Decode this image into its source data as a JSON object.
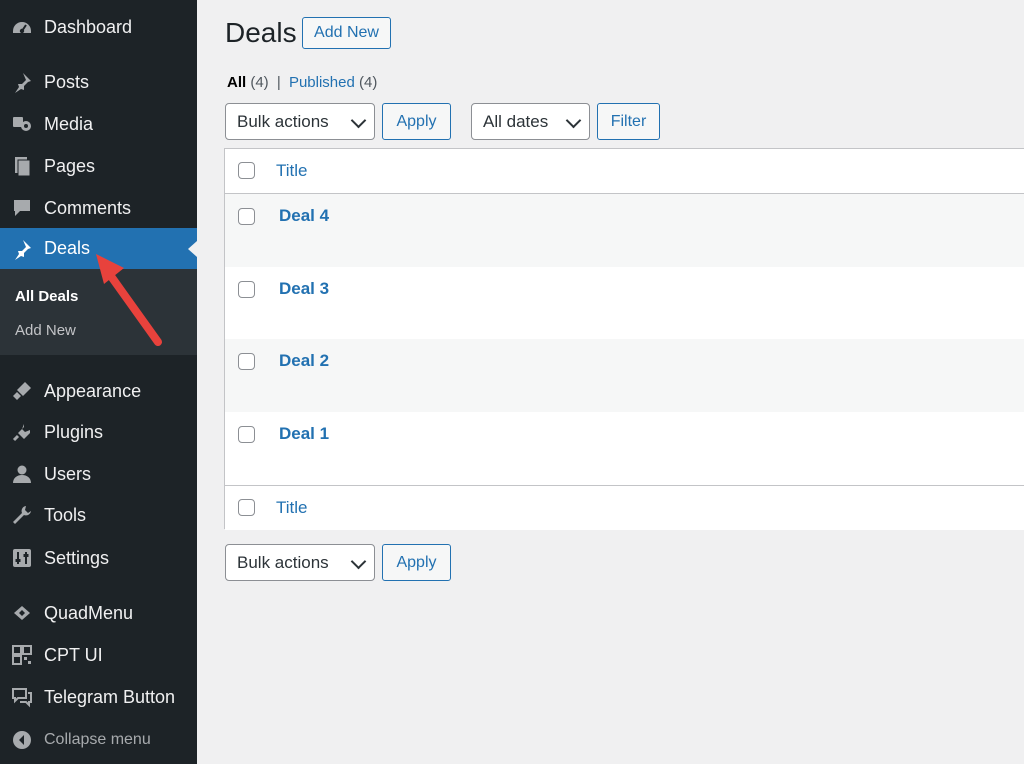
{
  "sidebar": {
    "items": [
      {
        "icon": "dashboard-icon",
        "label": "Dashboard"
      },
      {
        "icon": "pushpin-icon",
        "label": "Posts"
      },
      {
        "icon": "media-icon",
        "label": "Media"
      },
      {
        "icon": "pages-icon",
        "label": "Pages"
      },
      {
        "icon": "comment-icon",
        "label": "Comments"
      },
      {
        "icon": "pushpin-icon",
        "label": "Deals"
      },
      {
        "icon": "appearance-icon",
        "label": "Appearance"
      },
      {
        "icon": "plugin-icon",
        "label": "Plugins"
      },
      {
        "icon": "user-icon",
        "label": "Users"
      },
      {
        "icon": "wrench-icon",
        "label": "Tools"
      },
      {
        "icon": "settings-icon",
        "label": "Settings"
      },
      {
        "icon": "quadmenu-icon",
        "label": "QuadMenu"
      },
      {
        "icon": "cpt-ui-icon",
        "label": "CPT UI"
      },
      {
        "icon": "telegram-icon",
        "label": "Telegram Button"
      }
    ],
    "submenu": [
      "All Deals",
      "Add New"
    ],
    "collapse_label": "Collapse menu",
    "active_color": "#2271b1",
    "background_color": "#1d2327"
  },
  "header": {
    "title": "Deals",
    "add_new_label": "Add New"
  },
  "filters": {
    "all_label": "All",
    "all_count": "(4)",
    "separator": "|",
    "published_label": "Published",
    "published_count": "(4)"
  },
  "top_actions": {
    "bulk_select": "Bulk actions",
    "apply_label": "Apply",
    "dates_select": "All dates",
    "filter_label": "Filter"
  },
  "table": {
    "column_title": "Title",
    "rows": [
      "Deal 4",
      "Deal 3",
      "Deal 2",
      "Deal 1"
    ],
    "footer_title": "Title"
  },
  "bottom_actions": {
    "bulk_select": "Bulk actions",
    "apply_label": "Apply"
  },
  "annotation": {
    "arrow_color": "#e8423c"
  }
}
